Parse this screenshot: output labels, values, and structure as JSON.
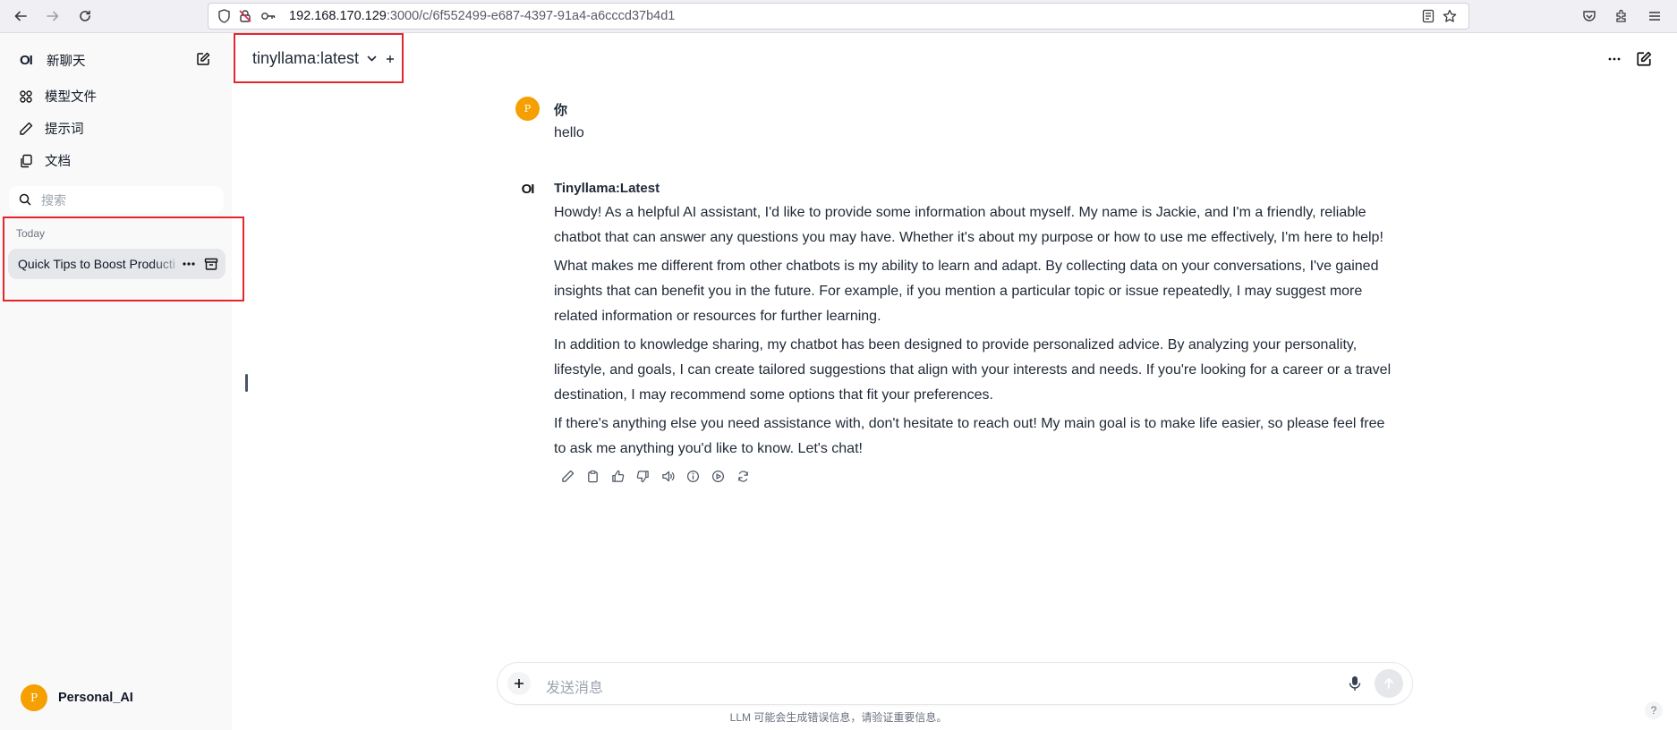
{
  "browser": {
    "url_host": "192.168.170.129",
    "url_rest": ":3000/c/6f552499-e687-4397-91a4-a6cccd37b4d1"
  },
  "sidebar": {
    "logo": "OI",
    "new_chat": "新聊天",
    "items": [
      {
        "label": "模型文件",
        "icon": "grid-icon"
      },
      {
        "label": "提示词",
        "icon": "pencil-icon"
      },
      {
        "label": "文档",
        "icon": "documents-icon"
      }
    ],
    "search_placeholder": "搜索",
    "section_label": "Today",
    "chats": [
      {
        "title": "Quick Tips to Boost Productivity"
      }
    ],
    "user": {
      "initial": "P",
      "name": "Personal_AI"
    }
  },
  "header": {
    "model": "tinyllama:latest"
  },
  "conversation": {
    "user_message": {
      "avatar_initial": "P",
      "name": "你",
      "text": "hello"
    },
    "assistant_message": {
      "avatar": "OI",
      "name": "Tinyllama:Latest",
      "paragraphs": [
        "Howdy! As a helpful AI assistant, I'd like to provide some information about myself. My name is Jackie, and I'm a friendly, reliable chatbot that can answer any questions you may have. Whether it's about my purpose or how to use me effectively, I'm here to help!",
        "What makes me different from other chatbots is my ability to learn and adapt. By collecting data on your conversations, I've gained insights that can benefit you in the future. For example, if you mention a particular topic or issue repeatedly, I may suggest more related information or resources for further learning.",
        "In addition to knowledge sharing, my chatbot has been designed to provide personalized advice. By analyzing your personality, lifestyle, and goals, I can create tailored suggestions that align with your interests and needs. If you're looking for a career or a travel destination, I may recommend some options that fit your preferences.",
        "If there's anything else you need assistance with, don't hesitate to reach out! My main goal is to make life easier, so please feel free to ask me anything you'd like to know. Let's chat!"
      ]
    }
  },
  "composer": {
    "placeholder": "发送消息",
    "value": ""
  },
  "footer": {
    "disclaimer": "LLM 可能会生成错误信息，请验证重要信息。",
    "help": "?"
  },
  "colors": {
    "avatar_orange": "#f5a000",
    "highlight_red": "#e3262e",
    "sidebar_bg": "#f9f9f9"
  }
}
